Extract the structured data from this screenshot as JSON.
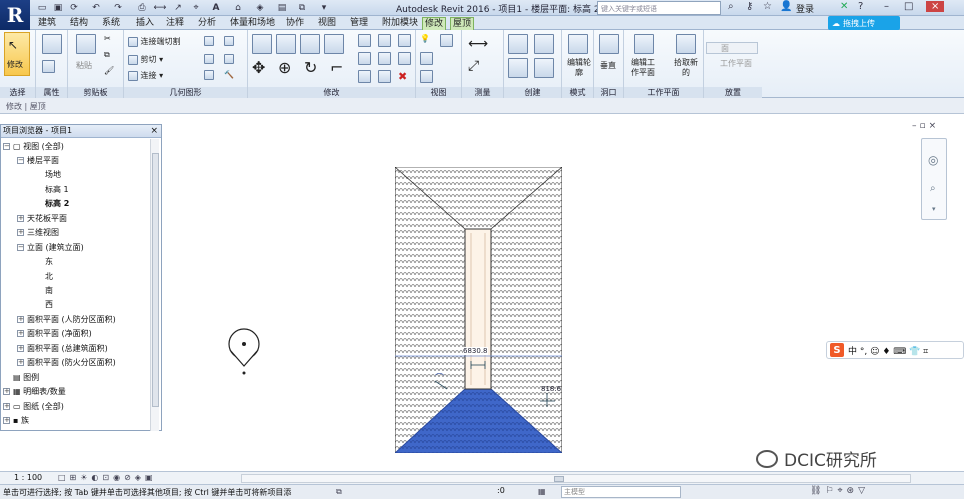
{
  "app": {
    "logo_letter": "R",
    "title": "Autodesk Revit 2016 -    项目1 - 楼层平面: 标高 2",
    "search_placeholder": "键入关键字或短语",
    "login_label": "登录",
    "upload_label": "拖拽上传"
  },
  "tabs": [
    {
      "label": "建筑"
    },
    {
      "label": "结构"
    },
    {
      "label": "系统"
    },
    {
      "label": "插入"
    },
    {
      "label": "注释"
    },
    {
      "label": "分析"
    },
    {
      "label": "体量和场地"
    },
    {
      "label": "协作"
    },
    {
      "label": "视图"
    },
    {
      "label": "管理"
    },
    {
      "label": "附加模块"
    },
    {
      "label": "修改"
    },
    {
      "label": "屋顶"
    }
  ],
  "ribbon": {
    "modify_label": "修改",
    "paste_label": "粘贴",
    "cope_label": "连接端切割",
    "cut_label": "剪切",
    "join_label": "连接",
    "edit_profile_label": "编辑轮廓",
    "vertical_label": "垂直",
    "edit_workplane_label": "编辑工作平面",
    "pick_new_label": "拾取新的",
    "face_label": "面",
    "workplane_label": "工作平面",
    "groups": {
      "select": "选择",
      "properties": "属性",
      "clipboard": "剪贴板",
      "geometry": "几何图形",
      "modify": "修改",
      "view": "视图",
      "measure": "测量",
      "create": "创建",
      "mode": "模式",
      "opening": "洞口",
      "workplane": "工作平面",
      "place": "放置"
    }
  },
  "options_bar": {
    "breadcrumb": "修改 | 屋顶"
  },
  "browser": {
    "title": "项目浏览器 - 项目1",
    "close": "×",
    "items": [
      {
        "label": "视图 (全部)",
        "twisty": "−"
      },
      {
        "label": "楼层平面",
        "twisty": "−"
      },
      {
        "label": "场地",
        "twisty": ""
      },
      {
        "label": "标高 1",
        "twisty": ""
      },
      {
        "label": "标高 2",
        "twisty": ""
      },
      {
        "label": "天花板平面",
        "twisty": "+"
      },
      {
        "label": "三维视图",
        "twisty": "+"
      },
      {
        "label": "立面 (建筑立面)",
        "twisty": "−"
      },
      {
        "label": "东",
        "twisty": ""
      },
      {
        "label": "北",
        "twisty": ""
      },
      {
        "label": "南",
        "twisty": ""
      },
      {
        "label": "西",
        "twisty": ""
      },
      {
        "label": "面积平面 (人防分区面积)",
        "twisty": "+"
      },
      {
        "label": "面积平面 (净面积)",
        "twisty": "+"
      },
      {
        "label": "面积平面 (总建筑面积)",
        "twisty": "+"
      },
      {
        "label": "面积平面 (防火分区面积)",
        "twisty": "+"
      },
      {
        "label": "图例",
        "twisty": ""
      },
      {
        "label": "明细表/数量",
        "twisty": "+"
      },
      {
        "label": "图纸 (全部)",
        "twisty": "+"
      },
      {
        "label": "族",
        "twisty": "+"
      }
    ]
  },
  "canvas": {
    "dim_width": "6830.8",
    "dim_right": "818.6"
  },
  "ime": {
    "logo": "S",
    "text": "中 °, ☺ ♦ ⌨ 👕 ⌗"
  },
  "viewbar": {
    "scale": "1 : 100"
  },
  "statusbar": {
    "text": "单击可进行选择; 按 Tab 键并单击可选择其他项目; 按 Ctrl 键并单击可将新项目添",
    "workset": ":0",
    "model_placeholder": "主模型"
  },
  "watermark": "DCIC研究所"
}
